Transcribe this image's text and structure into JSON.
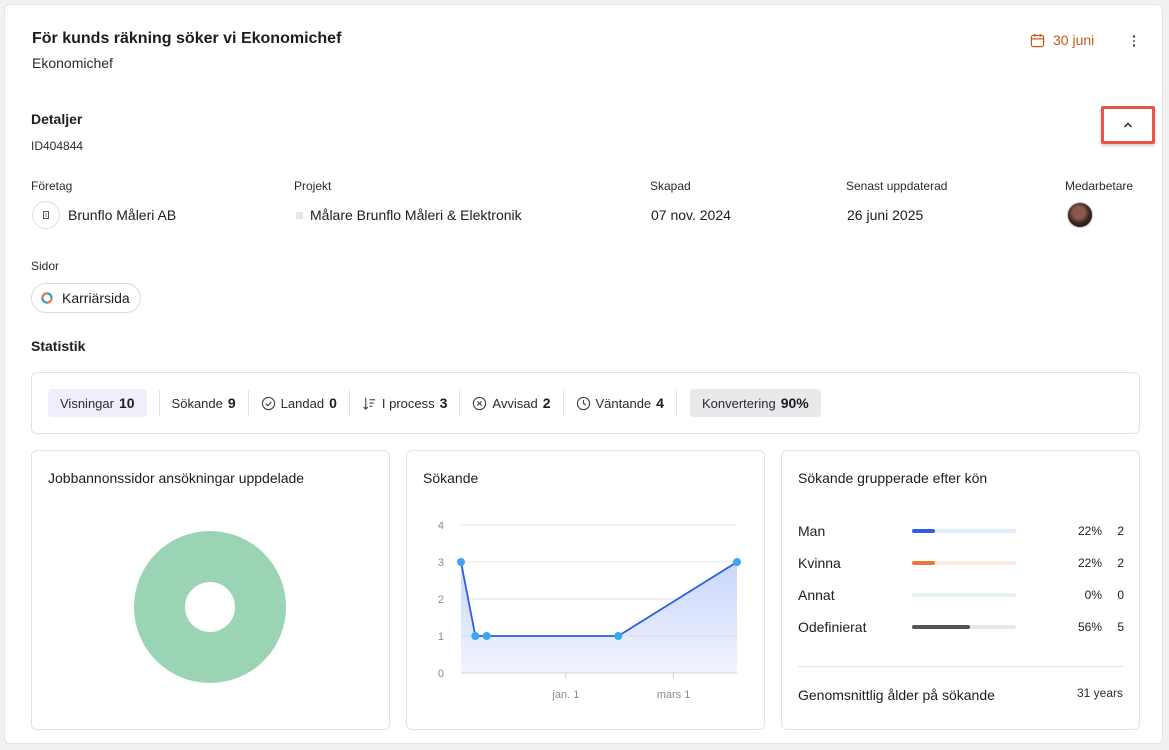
{
  "header": {
    "title": "För kunds räkning söker vi Ekonomichef",
    "subtitle": "Ekonomichef",
    "deadline": "30 juni",
    "accent_color": "#c85a1c"
  },
  "details": {
    "heading": "Detaljer",
    "id": "ID404844",
    "company_label": "Företag",
    "company_value": "Brunflo Måleri AB",
    "project_label": "Projekt",
    "project_value": "Målare Brunflo Måleri & Elektronik",
    "created_label": "Skapad",
    "created_value": "07 nov. 2024",
    "updated_label": "Senast uppdaterad",
    "updated_value": "26 juni 2025",
    "staff_label": "Medarbetare",
    "pages_label": "Sidor",
    "pages_value": "Karriärsida"
  },
  "stats": {
    "heading": "Statistik",
    "items": [
      {
        "label": "Visningar",
        "value": "10"
      },
      {
        "label": "Sökande",
        "value": "9"
      },
      {
        "label": "Landad",
        "value": "0"
      },
      {
        "label": "I process",
        "value": "3"
      },
      {
        "label": "Avvisad",
        "value": "2"
      },
      {
        "label": "Väntande",
        "value": "4"
      },
      {
        "label": "Konvertering",
        "value": "90%"
      }
    ]
  },
  "panels": {
    "donut_title": "Jobbannonssidor ansökningar uppdelade",
    "line_title": "Sökande",
    "gender_title": "Sökande grupperade efter kön",
    "avg_age_label": "Genomsnittlig ålder på sökande",
    "avg_age_value": "31 years"
  },
  "gender": [
    {
      "label": "Man",
      "pct": "22%",
      "count": "2",
      "fraction": 0.22,
      "color": "#2b5fdf",
      "track": "#e4ecfb"
    },
    {
      "label": "Kvinna",
      "pct": "22%",
      "count": "2",
      "fraction": 0.22,
      "color": "#e8773a",
      "track": "#fcebe1"
    },
    {
      "label": "Annat",
      "pct": "0%",
      "count": "0",
      "fraction": 0.0,
      "color": "#8fc6b0",
      "track": "#e7f1ed"
    },
    {
      "label": "Odefinierat",
      "pct": "56%",
      "count": "5",
      "fraction": 0.56,
      "color": "#555559",
      "track": "#e8e8ea"
    }
  ],
  "chart_data": [
    {
      "type": "pie",
      "slices": [
        {
          "value": 100,
          "color": "#9ad4b5"
        }
      ]
    },
    {
      "type": "area",
      "x_tick_labels": [
        "jan. 1",
        "mars 1"
      ],
      "ylim": [
        0,
        4
      ],
      "y_ticks": [
        "0",
        "1",
        "2",
        "3",
        "4"
      ],
      "series": [
        {
          "values": [
            3,
            1,
            1,
            1,
            3
          ],
          "color": "#2b5fdf",
          "fill": "#c8d6fb",
          "point_color": "#3aa7f0"
        }
      ]
    }
  ]
}
